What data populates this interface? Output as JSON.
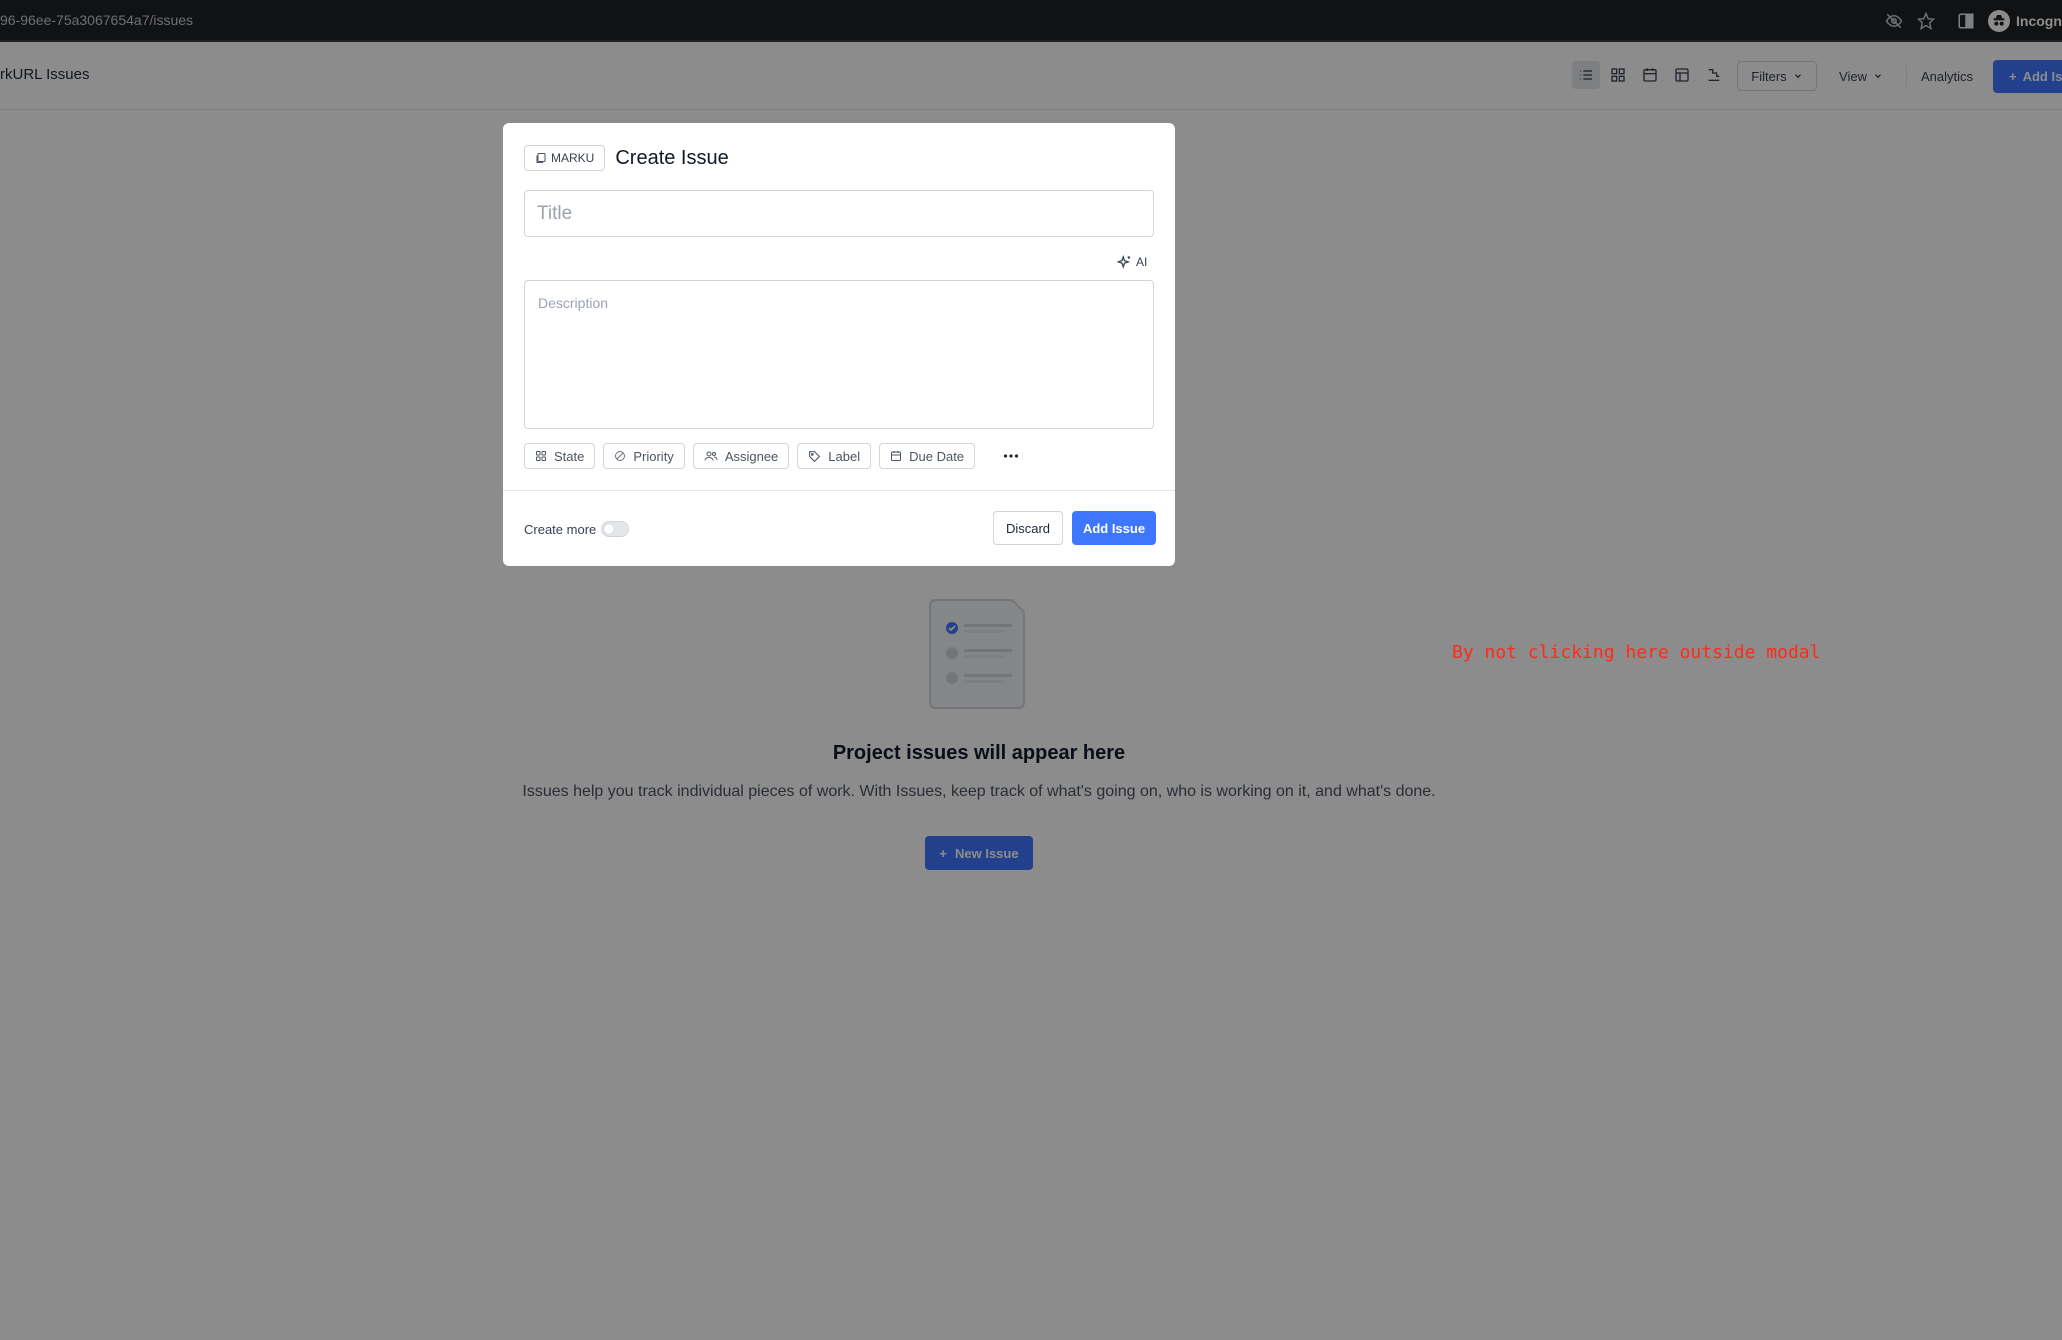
{
  "browser": {
    "url": "96-96ee-75a3067654a7/issues",
    "profile_label": "Incognito",
    "icons": [
      "eye-off-icon",
      "star-icon",
      "side-panel-icon",
      "incognito-icon"
    ]
  },
  "header": {
    "title": "rkURL Issues",
    "layout_icons": [
      "list-layout-icon",
      "kanban-layout-icon",
      "calendar-layout-icon",
      "spreadsheet-layout-icon",
      "gantt-layout-icon"
    ],
    "filters_label": "Filters",
    "view_label": "View",
    "analytics_label": "Analytics",
    "add_label": "Add Is"
  },
  "empty_state": {
    "title": "Project issues will appear here",
    "description": "Issues help you track individual pieces of work. With Issues, keep track of what's going on, who is working on it, and what's done.",
    "button_label": "New Issue"
  },
  "annotation": {
    "text": "By not clicking here outside modal",
    "color": "#ff2a1a"
  },
  "modal": {
    "project_label": "MARKU",
    "title": "Create Issue",
    "title_placeholder": "Title",
    "title_value": "",
    "ai_label": "AI",
    "description_placeholder": "Description",
    "description_value": "",
    "properties": {
      "state": "State",
      "priority": "Priority",
      "assignee": "Assignee",
      "label": "Label",
      "due_date": "Due Date"
    },
    "create_more_label": "Create more",
    "create_more_enabled": false,
    "discard_label": "Discard",
    "submit_label": "Add Issue"
  },
  "colors": {
    "accent": "#3f76ff",
    "overlay": "rgba(0,0,0,0.45)"
  }
}
